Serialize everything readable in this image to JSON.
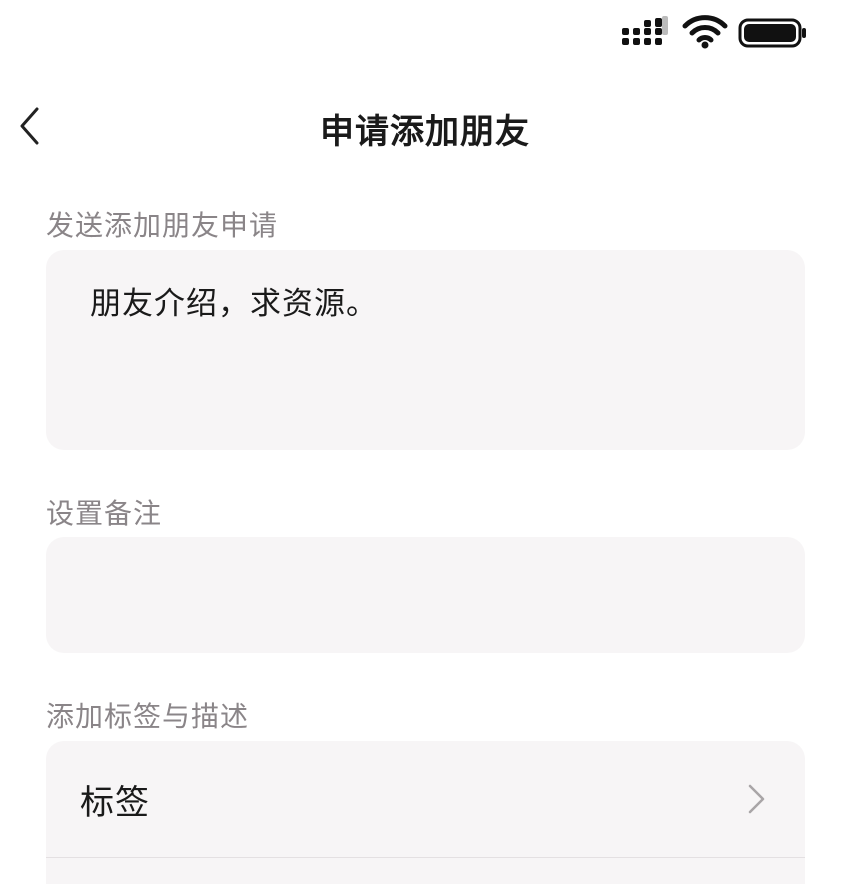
{
  "nav": {
    "title": "申请添加朋友",
    "back_icon": "chevron-left-icon"
  },
  "status_bar": {
    "icons": [
      "signal-icon",
      "wifi-icon",
      "battery-icon"
    ]
  },
  "request_section": {
    "label": "发送添加朋友申请",
    "message": "朋友介绍，求资源。"
  },
  "remark_section": {
    "label": "设置备注",
    "value": ""
  },
  "tags_section": {
    "label": "添加标签与描述",
    "rows": [
      {
        "label": "标签",
        "icon": "chevron-right-icon"
      }
    ]
  },
  "colors": {
    "field_background": "#f7f5f6",
    "section_label": "#8a8588",
    "text": "#1a1a1a"
  }
}
